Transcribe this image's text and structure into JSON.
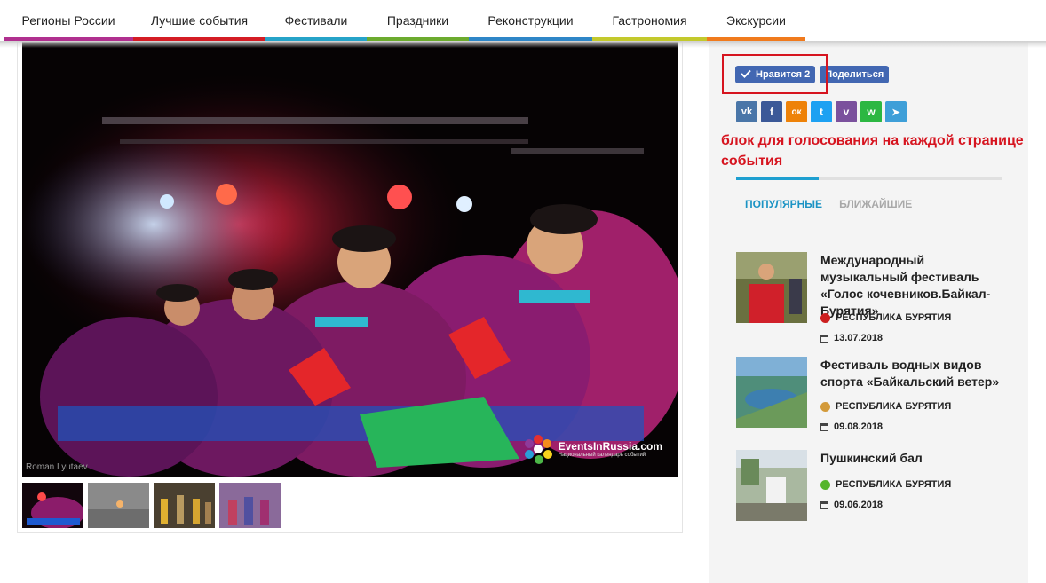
{
  "nav": {
    "items": [
      {
        "label": "Регионы России",
        "color": "#b0308f"
      },
      {
        "label": "Лучшие события",
        "color": "#d41c24"
      },
      {
        "label": "Фестивали",
        "color": "#26a3c8"
      },
      {
        "label": "Праздники",
        "color": "#6cab2e"
      },
      {
        "label": "Реконструкции",
        "color": "#2f86c7"
      },
      {
        "label": "Гастрономия",
        "color": "#c3c92c"
      },
      {
        "label": "Экскурсии",
        "color": "#f07a1d"
      }
    ]
  },
  "photo": {
    "credit": "Roman Lyutaev",
    "watermark_name": "EventsInRussia.com",
    "watermark_sub": "Национальный календарь событий",
    "thumbnails": [
      "thumb-1",
      "thumb-2",
      "thumb-3",
      "thumb-4"
    ]
  },
  "sidebar": {
    "like_label": "Нравится",
    "like_count": "2",
    "share_label": "Поделиться",
    "social": [
      {
        "icon": "vk-icon",
        "glyph": "vk",
        "color": "#4a76a8"
      },
      {
        "icon": "facebook-icon",
        "glyph": "f",
        "color": "#3b5998"
      },
      {
        "icon": "odnoklassniki-icon",
        "glyph": "ок",
        "color": "#ee8208"
      },
      {
        "icon": "twitter-icon",
        "glyph": "t",
        "color": "#1da1f2"
      },
      {
        "icon": "viber-icon",
        "glyph": "v",
        "color": "#7b519d"
      },
      {
        "icon": "whatsapp-icon",
        "glyph": "w",
        "color": "#2cb742"
      },
      {
        "icon": "telegram-icon",
        "glyph": "➤",
        "color": "#3e9fd8"
      }
    ],
    "annotation": "блок для голосования на каждой странице события",
    "tabs": {
      "popular": "ПОПУЛЯРНЫЕ",
      "nearest": "БЛИЖАЙШИЕ"
    },
    "events": [
      {
        "title": "Международный музыкальный фестиваль «Голос кочевников.Байкал-Бурятия»",
        "region": "РЕСПУБЛИКА БУРЯТИЯ",
        "region_color": "#cc1f1f",
        "date": "13.07.2018"
      },
      {
        "title": "Фестиваль водных видов спорта «Байкальский ветер»",
        "region": "РЕСПУБЛИКА БУРЯТИЯ",
        "region_color": "#d39a3a",
        "date": "09.08.2018"
      },
      {
        "title": "Пушкинский бал",
        "region": "РЕСПУБЛИКА БУРЯТИЯ",
        "region_color": "#55b52b",
        "date": "09.06.2018"
      }
    ]
  }
}
